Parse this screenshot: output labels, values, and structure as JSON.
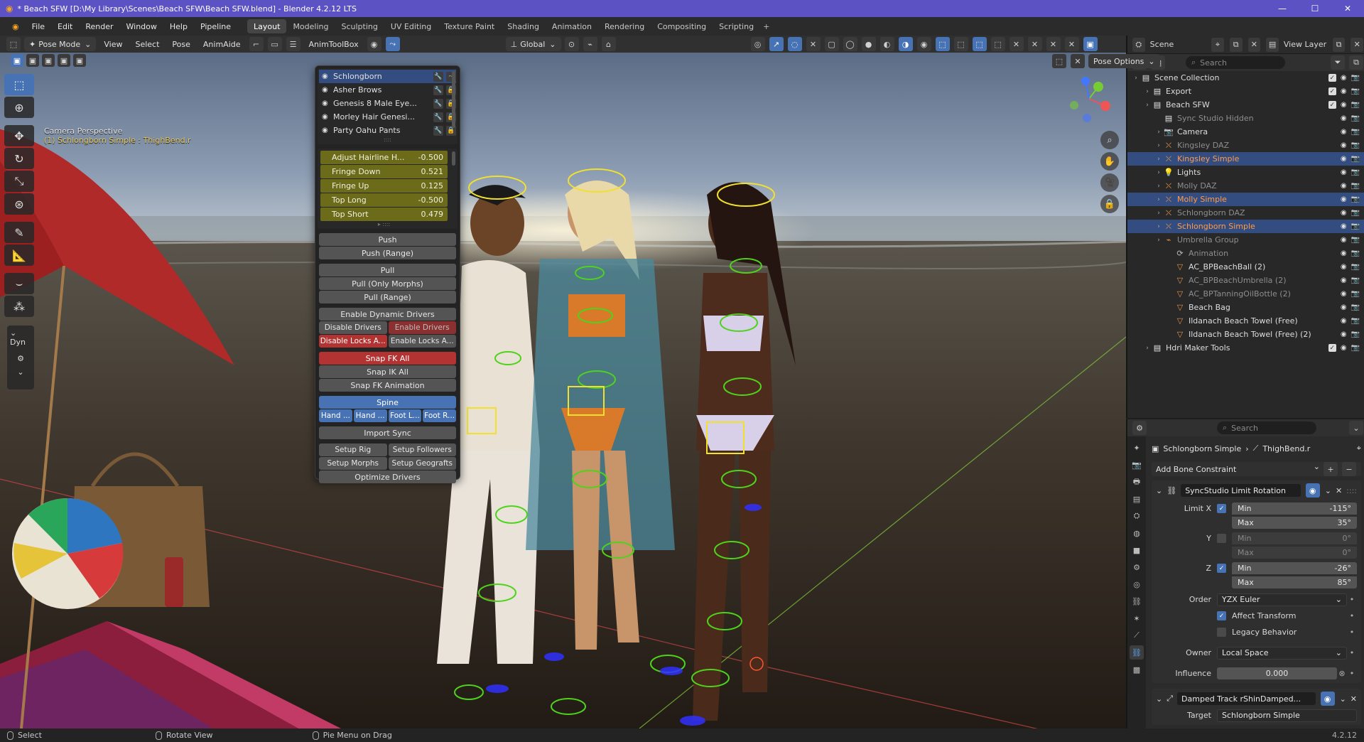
{
  "window": {
    "title": "* Beach SFW [D:\\My Library\\Scenes\\Beach SFW\\Beach SFW.blend] - Blender 4.2.12 LTS",
    "controls": [
      "—",
      "☐",
      "✕"
    ]
  },
  "menubar": {
    "menus": [
      "File",
      "Edit",
      "Render",
      "Window",
      "Help",
      "Pipeline"
    ],
    "workspaces": [
      "Layout",
      "Modeling",
      "Sculpting",
      "UV Editing",
      "Texture Paint",
      "Shading",
      "Animation",
      "Rendering",
      "Compositing",
      "Scripting"
    ],
    "active_workspace": "Layout",
    "add_tab": "+"
  },
  "viewport_header": {
    "mode": "Pose Mode",
    "menus": [
      "View",
      "Select",
      "Pose",
      "AnimAide"
    ],
    "animtoolbox": "AnimToolBox",
    "orientation": "Global",
    "pose_options": "Pose Options"
  },
  "viewport": {
    "camera_label": "Camera Perspective",
    "active_bone": "(1) Schlongborn Simple : ThighBend.r",
    "dyn_label": "Dyn"
  },
  "popup": {
    "characters": [
      {
        "name": "Schlongborn",
        "selected": true
      },
      {
        "name": "Asher Brows",
        "selected": false
      },
      {
        "name": "Genesis 8 Male Eye...",
        "selected": false
      },
      {
        "name": "Morley Hair Genesi...",
        "selected": false
      },
      {
        "name": "Party Oahu Pants",
        "selected": false
      }
    ],
    "morphs": [
      {
        "name": "Adjust Hairline H...",
        "value": "-0.500"
      },
      {
        "name": "Fringe Down",
        "value": "0.521"
      },
      {
        "name": "Fringe Up",
        "value": "0.125"
      },
      {
        "name": "Top Long",
        "value": "-0.500"
      },
      {
        "name": "Top Short",
        "value": "0.479"
      }
    ],
    "buttons": {
      "push": "Push",
      "push_range": "Push (Range)",
      "pull": "Pull",
      "pull_only_morphs": "Pull (Only Morphs)",
      "pull_range": "Pull (Range)",
      "enable_dynamic_drivers": "Enable Dynamic Drivers",
      "disable_drivers": "Disable Drivers",
      "enable_drivers": "Enable Drivers",
      "disable_locks": "Disable Locks A...",
      "enable_locks": "Enable Locks A...",
      "snap_fk_all": "Snap FK All",
      "snap_ik_all": "Snap IK All",
      "snap_fk_animation": "Snap FK Animation",
      "spine": "Spine",
      "hand_l": "Hand ...",
      "hand_r": "Hand ...",
      "foot_l": "Foot L...",
      "foot_r": "Foot R...",
      "import_sync": "Import Sync",
      "setup_rig": "Setup Rig",
      "setup_followers": "Setup Followers",
      "setup_morphs": "Setup Morphs",
      "setup_geografts": "Setup Geografts",
      "optimize_drivers": "Optimize Drivers"
    }
  },
  "outliner": {
    "search_placeholder": "Search",
    "scene": "Scene",
    "view_layer": "View Layer",
    "rows": [
      {
        "name": "Scene Collection",
        "depth": 0,
        "icon": "collection",
        "state": "normal"
      },
      {
        "name": "Export",
        "depth": 1,
        "icon": "collection",
        "state": "normal"
      },
      {
        "name": "Beach SFW",
        "depth": 1,
        "icon": "collection",
        "state": "normal"
      },
      {
        "name": "Sync Studio Hidden",
        "depth": 2,
        "icon": "collection",
        "state": "dim"
      },
      {
        "name": "Camera",
        "depth": 2,
        "icon": "camera",
        "state": "normal"
      },
      {
        "name": "Kingsley DAZ",
        "depth": 2,
        "icon": "armature",
        "state": "dim"
      },
      {
        "name": "Kingsley Simple",
        "depth": 2,
        "icon": "armature",
        "state": "selected"
      },
      {
        "name": "Lights",
        "depth": 2,
        "icon": "light",
        "state": "normal"
      },
      {
        "name": "Molly DAZ",
        "depth": 2,
        "icon": "armature",
        "state": "dim"
      },
      {
        "name": "Molly Simple",
        "depth": 2,
        "icon": "armature",
        "state": "selected"
      },
      {
        "name": "Schlongborn DAZ",
        "depth": 2,
        "icon": "armature",
        "state": "dim"
      },
      {
        "name": "Schlongborn Simple",
        "depth": 2,
        "icon": "armature",
        "state": "selected"
      },
      {
        "name": "Umbrella Group",
        "depth": 2,
        "icon": "empty",
        "state": "dim"
      },
      {
        "name": "Animation",
        "depth": 3,
        "icon": "animation",
        "state": "dim"
      },
      {
        "name": "AC_BPBeachBall (2)",
        "depth": 3,
        "icon": "mesh",
        "state": "normal"
      },
      {
        "name": "AC_BPBeachUmbrella (2)",
        "depth": 3,
        "icon": "mesh",
        "state": "dim"
      },
      {
        "name": "AC_BPTanningOilBottle (2)",
        "depth": 3,
        "icon": "mesh",
        "state": "dim"
      },
      {
        "name": "Beach Bag",
        "depth": 3,
        "icon": "mesh",
        "state": "normal"
      },
      {
        "name": "Ildanach Beach Towel (Free)",
        "depth": 3,
        "icon": "mesh",
        "state": "normal"
      },
      {
        "name": "Ildanach Beach Towel (Free) (2)",
        "depth": 3,
        "icon": "mesh",
        "state": "normal"
      },
      {
        "name": "Hdri Maker Tools",
        "depth": 1,
        "icon": "collection",
        "state": "normal"
      }
    ]
  },
  "properties": {
    "search_placeholder": "Search",
    "object": "Schlongborn Simple",
    "bone": "ThighBend.r",
    "add_constraint": "Add Bone Constraint",
    "constraint1": {
      "name": "SyncStudio Limit Rotation",
      "limit_x": {
        "label": "Limit X",
        "enabled": true,
        "min": "-115°",
        "max": "35°"
      },
      "limit_y": {
        "label": "Y",
        "enabled": false,
        "min": "0°",
        "max": "0°"
      },
      "limit_z": {
        "label": "Z",
        "enabled": true,
        "min": "-26°",
        "max": "85°"
      },
      "min_label": "Min",
      "max_label": "Max",
      "order_label": "Order",
      "order": "YZX Euler",
      "affect_transform": "Affect Transform",
      "legacy_behavior": "Legacy Behavior",
      "owner_label": "Owner",
      "owner": "Local Space",
      "influence_label": "Influence",
      "influence": "0.000"
    },
    "constraint2": {
      "name": "Damped Track rShinDamped...",
      "target_label": "Target",
      "target": "Schlongborn Simple"
    }
  },
  "statusbar": {
    "select": "Select",
    "rotate": "Rotate View",
    "pie": "Pie Menu on Drag",
    "version": "4.2.12"
  },
  "colors": {
    "titlebar": "#5c52c4",
    "accent": "#4772b3",
    "morph_slider": "#6b6b1a",
    "danger": "#b33333"
  }
}
